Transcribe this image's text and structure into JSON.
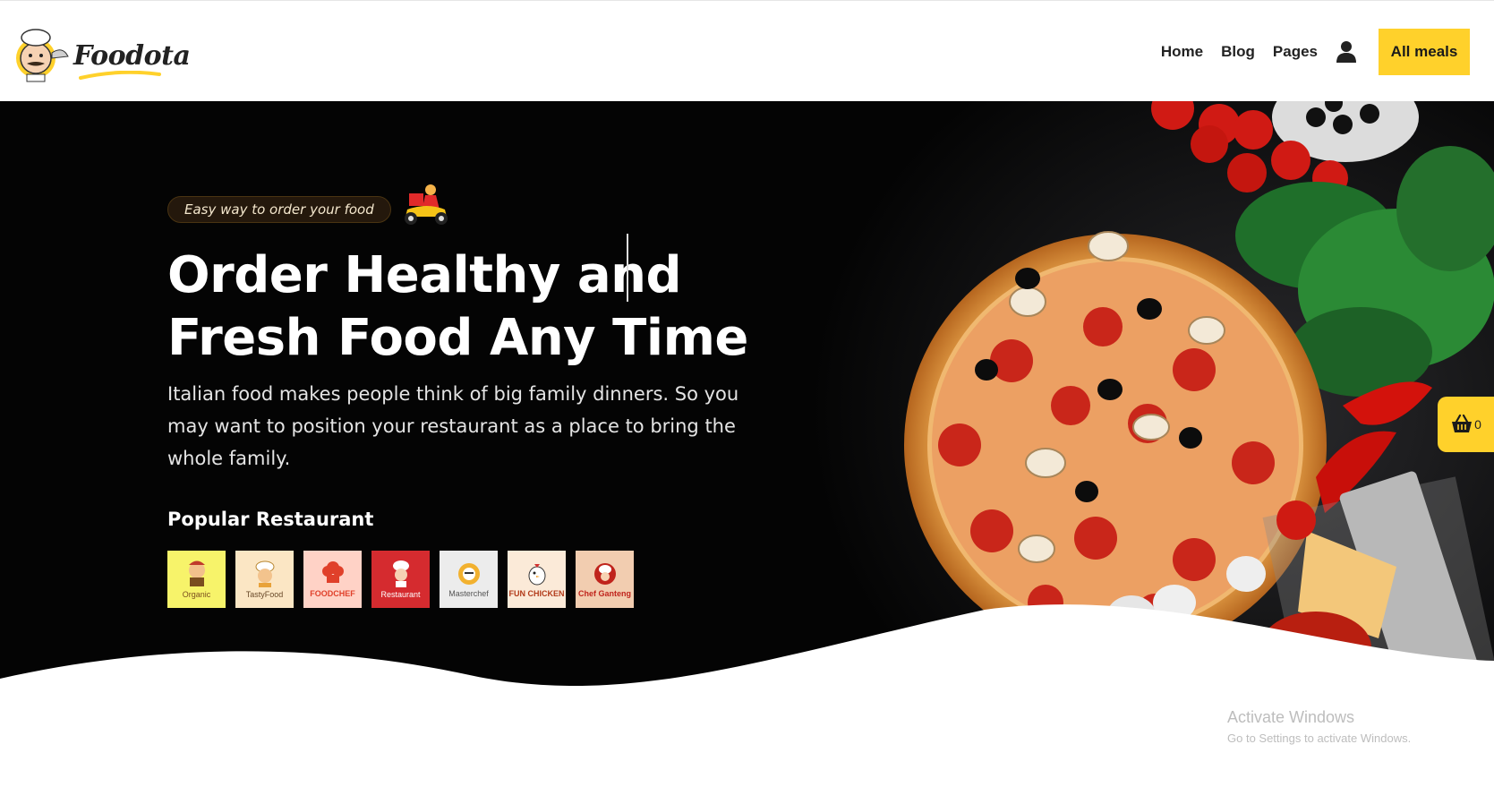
{
  "header": {
    "logo_text": "Foodota",
    "nav": [
      "Home",
      "Blog",
      "Pages"
    ],
    "cta_label": "All meals"
  },
  "hero": {
    "tagline": "Easy way to order your food",
    "headline_line1": "Order Healthy and",
    "headline_line2": "Fresh Food Any Time",
    "description": "Italian food makes people think of big family dinners. So you may want to position your restaurant as a place to bring the whole family.",
    "popular_title": "Popular Restaurant",
    "restaurants": [
      {
        "label": "Organic",
        "bg": "#f7f36a",
        "ink": "#7a4d1f"
      },
      {
        "label": "TastyFood",
        "bg": "#fbe6c4",
        "ink": "#6a4a2a"
      },
      {
        "label": "FOODCHEF",
        "bg": "#ffd2c6",
        "ink": "#e0402a"
      },
      {
        "label": "Restaurant",
        "bg": "#d52b2f",
        "ink": "#ffffff"
      },
      {
        "label": "Masterchef",
        "bg": "#ececec",
        "ink": "#555555"
      },
      {
        "label": "FUN CHICKEN",
        "bg": "#fbead8",
        "ink": "#b23b1a"
      },
      {
        "label": "Chef Ganteng",
        "bg": "#f2cdb0",
        "ink": "#c0241c"
      }
    ]
  },
  "cart": {
    "count": "0"
  },
  "watermark": {
    "title": "Activate Windows",
    "subtitle": "Go to Settings to activate Windows."
  },
  "colors": {
    "accent": "#ffd12b",
    "hero_bg": "#040404"
  }
}
